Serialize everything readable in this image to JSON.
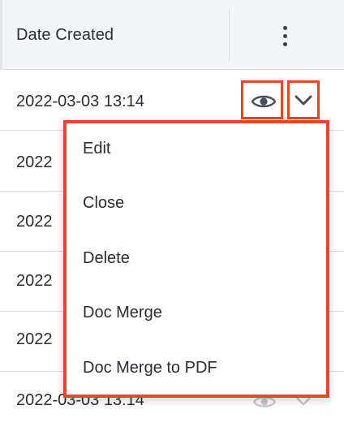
{
  "header": {
    "column_title": "Date Created",
    "actions_icon": "more-vertical-icon"
  },
  "rows": [
    {
      "date": "2022-03-03 13:14"
    },
    {
      "date": "2022"
    },
    {
      "date": "2022"
    },
    {
      "date": "2022"
    },
    {
      "date": "2022"
    },
    {
      "date": "2022-03-03 13:14"
    }
  ],
  "row_actions": {
    "preview_icon": "eye-icon",
    "dropdown_icon": "chevron-down-icon"
  },
  "menu": {
    "items": [
      "Edit",
      "Close",
      "Delete",
      "Doc Merge",
      "Doc Merge to PDF"
    ]
  },
  "colors": {
    "highlight": "#e8452f",
    "header_bg": "#f4f5f7",
    "text": "#2b2d31",
    "icon": "#4a4f57",
    "border": "#dcdee2"
  }
}
